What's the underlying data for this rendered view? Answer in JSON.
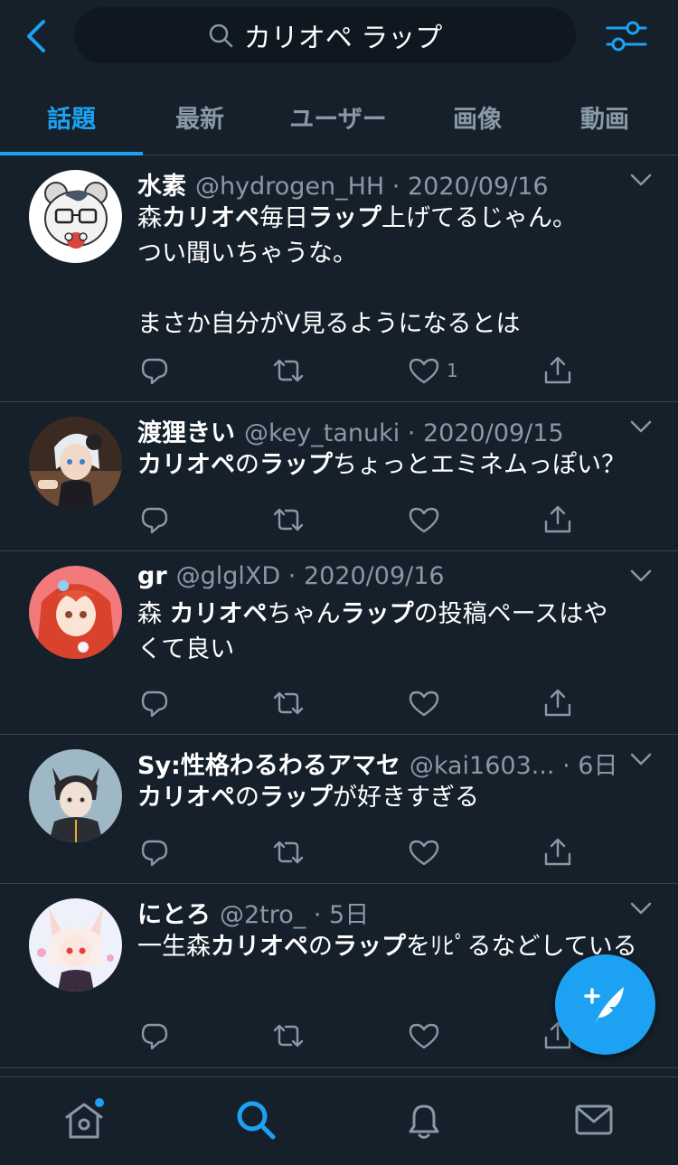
{
  "colors": {
    "background": "#15202b",
    "accent": "#1da1f2",
    "secondary_text": "#8899a6",
    "divider": "#38444d"
  },
  "header": {
    "back_icon": "chevron-left-icon",
    "search_icon": "search-icon",
    "search_query": "カリオペ ラップ",
    "filter_icon": "sliders-icon"
  },
  "tabs": [
    {
      "label": "話題",
      "active": true
    },
    {
      "label": "最新",
      "active": false
    },
    {
      "label": "ユーザー",
      "active": false
    },
    {
      "label": "画像",
      "active": false
    },
    {
      "label": "動画",
      "active": false
    }
  ],
  "tweets": [
    {
      "name": "水素",
      "handle": "@hydrogen_HH · 2020/09/16",
      "text_segments": [
        {
          "t": "森",
          "b": false
        },
        {
          "t": "カリオペ",
          "b": true
        },
        {
          "t": "毎日",
          "b": false
        },
        {
          "t": "ラップ",
          "b": true
        },
        {
          "t": "上げてるじゃん。\nつい聞いちゃうな。\n\nまさか自分がV見るようになるとは",
          "b": false
        }
      ],
      "like_count": "1"
    },
    {
      "name": "渡狸きい",
      "handle": "@key_tanuki · 2020/09/15",
      "text_segments": [
        {
          "t": "カリオペ",
          "b": true
        },
        {
          "t": "の",
          "b": false
        },
        {
          "t": "ラップ",
          "b": true
        },
        {
          "t": "ちょっとエミネムっぽい？",
          "b": false
        }
      ],
      "like_count": ""
    },
    {
      "name": "gr",
      "handle": "@glglXD · 2020/09/16",
      "text_segments": [
        {
          "t": "森 ",
          "b": false
        },
        {
          "t": "カリオペ",
          "b": true
        },
        {
          "t": "ちゃん",
          "b": false
        },
        {
          "t": "ラップ",
          "b": true
        },
        {
          "t": "の投稿ペースはやくて良い",
          "b": false
        }
      ],
      "like_count": ""
    },
    {
      "name": "Sy:性格わるわるアマセ",
      "handle": "@kai1603... · 6日",
      "text_segments": [
        {
          "t": "カリオペ",
          "b": true
        },
        {
          "t": "の",
          "b": false
        },
        {
          "t": "ラップ",
          "b": true
        },
        {
          "t": "が好きすぎる",
          "b": false
        }
      ],
      "like_count": ""
    },
    {
      "name": "にとろ",
      "handle": "@2tro_ · 5日",
      "text_segments": [
        {
          "t": "一生森",
          "b": false
        },
        {
          "t": "カリオペ",
          "b": true
        },
        {
          "t": "の",
          "b": false
        },
        {
          "t": "ラップ",
          "b": true
        },
        {
          "t": "をﾘﾋﾟるなどしている",
          "b": false
        }
      ],
      "like_count": ""
    }
  ],
  "action_icons": [
    "reply-icon",
    "retweet-icon",
    "like-icon",
    "share-icon"
  ],
  "fab": {
    "icon": "compose-tweet-icon"
  },
  "bottom_nav": [
    {
      "icon": "home-icon",
      "active": false,
      "has_dot": true
    },
    {
      "icon": "search-icon",
      "active": true,
      "has_dot": false
    },
    {
      "icon": "bell-icon",
      "active": false,
      "has_dot": false
    },
    {
      "icon": "mail-icon",
      "active": false,
      "has_dot": false
    }
  ]
}
